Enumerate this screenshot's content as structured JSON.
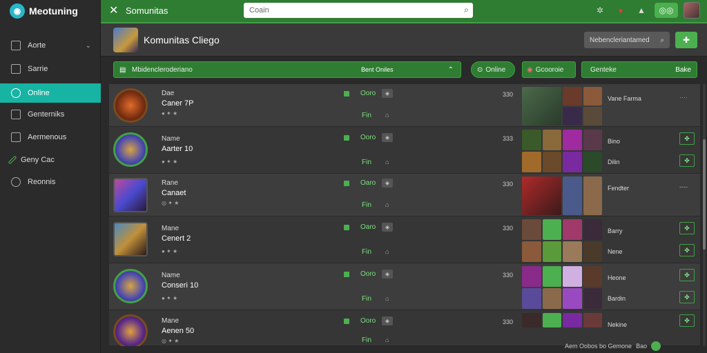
{
  "brand": {
    "name": "Meotuning"
  },
  "sidebar": {
    "items": [
      {
        "label": "Aorte",
        "icon": "home-icon"
      },
      {
        "label": "Sarrie",
        "icon": "store-icon"
      },
      {
        "label": "Online",
        "icon": "globe-icon",
        "active": true
      },
      {
        "label": "Genterniks",
        "icon": "gamepad-icon"
      },
      {
        "label": "Aermenous",
        "icon": "folder-icon"
      },
      {
        "label": "Geny Cac",
        "icon": "pen-icon"
      },
      {
        "label": "Reonnis",
        "icon": "gear-icon"
      }
    ]
  },
  "topbar": {
    "title": "Somunitas",
    "search_placeholder": "Coain"
  },
  "header": {
    "title": "Komunitas Cliego",
    "button_label": "Nebencleriantamed"
  },
  "filters": {
    "main_label": "Mbidencleroderiano",
    "main_right": "Bent Oniles",
    "online_label": "Online",
    "second_label": "Gcooroie",
    "third_label": "Genteke",
    "third_right": "Bake"
  },
  "rows": [
    {
      "line1": "Dae",
      "line2": "Caner 7P",
      "code": "Ooro",
      "fin": "Fin",
      "num": "330",
      "name": "Vane Farma",
      "name2": "",
      "more": "····"
    },
    {
      "line1": "Name",
      "line2": "Aarter 10",
      "code": "Ooro",
      "fin": "Fin",
      "num": "333",
      "name": "Bino",
      "name2": "Dilin",
      "more": ""
    },
    {
      "line1": "Rane",
      "line2": "Canaet",
      "code": "Oaro",
      "fin": "Fin",
      "num": "330",
      "name": "Fendter",
      "name2": "",
      "more": "----"
    },
    {
      "line1": "Mane",
      "line2": "Cenert 2",
      "code": "Oaro",
      "fin": "Fin",
      "num": "330",
      "name": "Barry",
      "name2": "Nene",
      "more": ""
    },
    {
      "line1": "Name",
      "line2": "Conseri 10",
      "code": "Ooro",
      "fin": "Fin",
      "num": "330",
      "name": "Heone",
      "name2": "Bardin",
      "more": ""
    },
    {
      "line1": "Mane",
      "line2": "Aenen 50",
      "code": "Ooro",
      "fin": "Fin",
      "num": "330",
      "name": "Nekine",
      "name2": "",
      "more": ""
    }
  ],
  "footer": {
    "label": "Aem Oobos bo Gemone",
    "extra": "Bao"
  },
  "colors": {
    "accent": "#2e7d32",
    "active_nav": "#17b3a3",
    "highlight": "#7ee07e"
  }
}
